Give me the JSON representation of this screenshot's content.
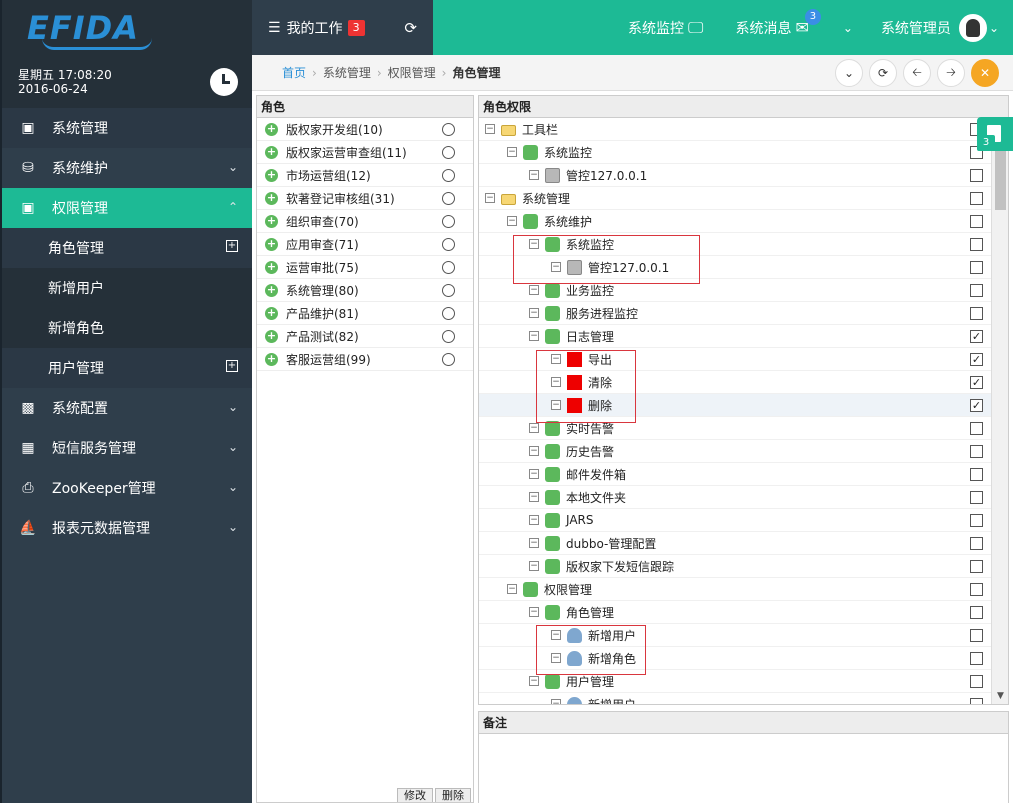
{
  "logo": "EFIDA",
  "datetime": {
    "line1": "星期五 17:08:20",
    "line2": "2016-06-24"
  },
  "sidebar": {
    "items": [
      {
        "label": "系统管理",
        "icon": "sitemap-icon"
      },
      {
        "label": "系统维护",
        "icon": "truck-icon"
      },
      {
        "label": "权限管理",
        "icon": "image-icon"
      },
      {
        "label": "系统配置",
        "icon": "cc-icon"
      },
      {
        "label": "短信服务管理",
        "icon": "building-icon"
      },
      {
        "label": "ZooKeeper管理",
        "icon": "printer-icon"
      },
      {
        "label": "报表元数据管理",
        "icon": "ship-icon"
      }
    ],
    "sub_items": [
      {
        "label": "角色管理"
      },
      {
        "label": "新增用户"
      },
      {
        "label": "新增角色"
      },
      {
        "label": "用户管理"
      }
    ]
  },
  "topbar": {
    "my_work": "我的工作",
    "my_work_badge": "3",
    "monitor": "系统监控",
    "messages": "系统消息",
    "messages_badge": "3",
    "user": "系统管理员"
  },
  "breadcrumb": [
    "首页",
    "系统管理",
    "权限管理",
    "角色管理"
  ],
  "roles_panel": {
    "title": "角色",
    "roles": [
      "版权家开发组(10)",
      "版权家运营审查组(11)",
      "市场运营组(12)",
      "软著登记审核组(31)",
      "组织审查(70)",
      "应用审查(71)",
      "运营审批(75)",
      "系统管理(80)",
      "产品维护(81)",
      "产品测试(82)",
      "客服运营组(99)"
    ],
    "edit_label": "修改",
    "delete_label": "删除"
  },
  "perm_panel": {
    "title": "角色权限",
    "rows": [
      {
        "label": "工具栏",
        "checked": ""
      },
      {
        "label": "系统监控",
        "checked": ""
      },
      {
        "label": "管控127.0.0.1",
        "checked": ""
      },
      {
        "label": "系统管理",
        "checked": ""
      },
      {
        "label": "系统维护",
        "checked": ""
      },
      {
        "label": "系统监控",
        "checked": ""
      },
      {
        "label": "管控127.0.0.1",
        "checked": ""
      },
      {
        "label": "业务监控",
        "checked": ""
      },
      {
        "label": "服务进程监控",
        "checked": ""
      },
      {
        "label": "日志管理",
        "checked": "✓"
      },
      {
        "label": "导出",
        "checked": "✓"
      },
      {
        "label": "清除",
        "checked": "✓"
      },
      {
        "label": "删除",
        "checked": "✓"
      },
      {
        "label": "实时告警",
        "checked": ""
      },
      {
        "label": "历史告警",
        "checked": ""
      },
      {
        "label": "邮件发件箱",
        "checked": ""
      },
      {
        "label": "本地文件夹",
        "checked": ""
      },
      {
        "label": "JARS",
        "checked": ""
      },
      {
        "label": "dubbo-管理配置",
        "checked": ""
      },
      {
        "label": "版权家下发短信跟踪",
        "checked": ""
      },
      {
        "label": "权限管理",
        "checked": ""
      },
      {
        "label": "角色管理",
        "checked": ""
      },
      {
        "label": "新增用户",
        "checked": ""
      },
      {
        "label": "新增角色",
        "checked": ""
      },
      {
        "label": "用户管理",
        "checked": ""
      },
      {
        "label": "新增用户",
        "checked": ""
      }
    ]
  },
  "note_panel": {
    "title": "备注"
  },
  "side_tab_badge": "3",
  "colors": {
    "accent": "#1dba95",
    "sidebar": "#2f3e4b",
    "alert": "#e33333"
  }
}
